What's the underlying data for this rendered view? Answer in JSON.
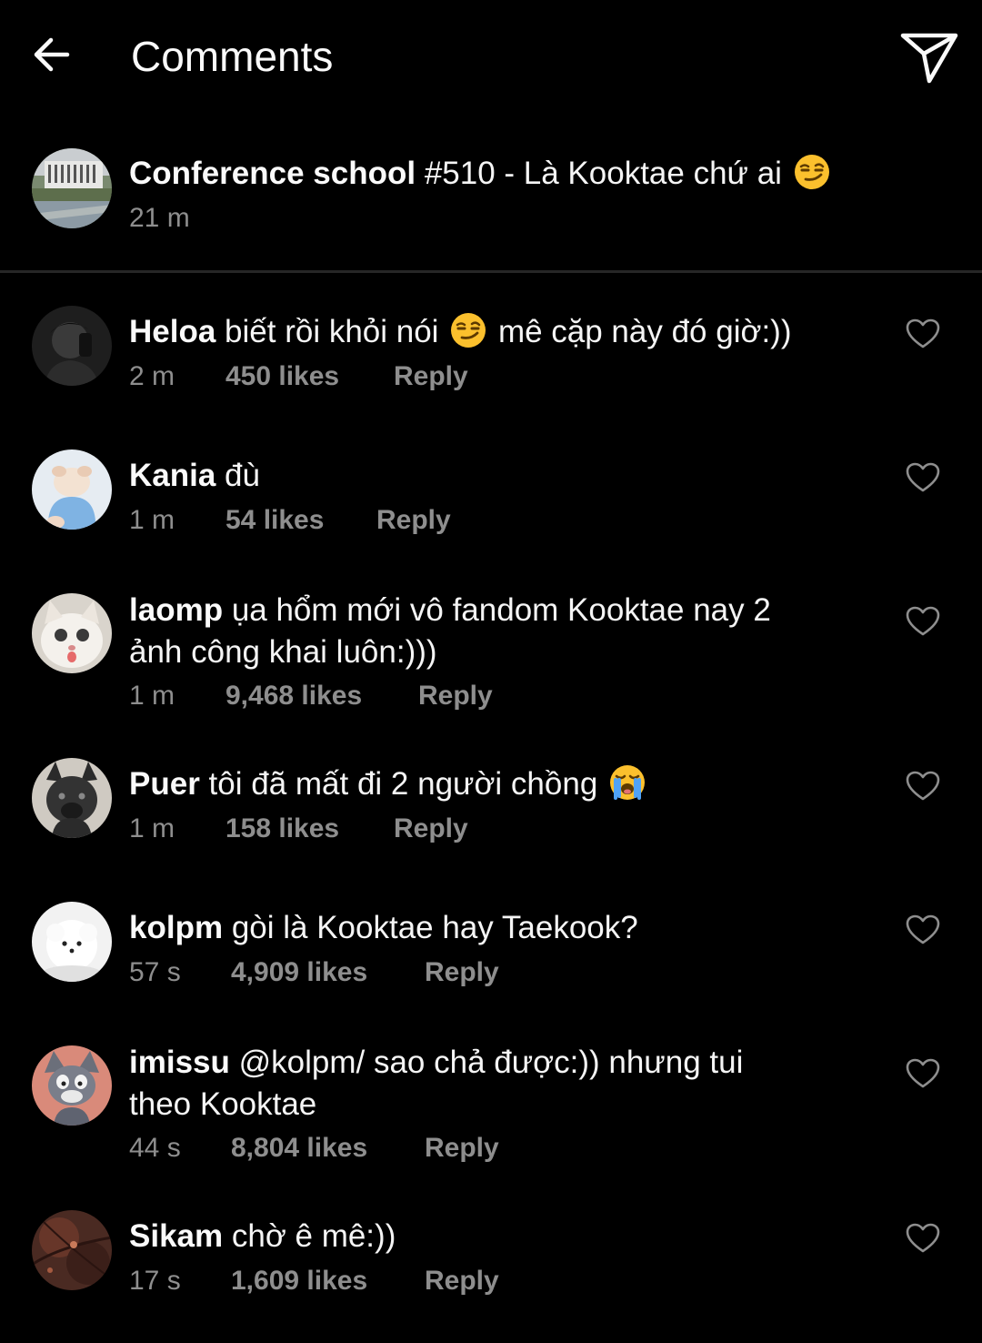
{
  "header": {
    "title": "Comments",
    "back_icon": "arrow-left-icon",
    "send_icon": "paper-plane-icon"
  },
  "caption": {
    "username": "Conference school",
    "text": "#510 - Là Kooktae chứ ai",
    "emoji": "smirk-emoji",
    "time": "21 m"
  },
  "comments": [
    {
      "username": "Heloa",
      "text_before": "biết rồi khỏi nói",
      "emoji": "smirk-emoji",
      "text_after": "mê cặp này đó giờ:))",
      "time": "2 m",
      "likes": "450 likes",
      "reply": "Reply"
    },
    {
      "username": "Kania",
      "text": "đù",
      "time": "1 m",
      "likes": "54 likes",
      "reply": "Reply"
    },
    {
      "username": "laomp",
      "text_line1": "ụa hổm mới vô fandom Kooktae nay 2",
      "text_line2": "ảnh công khai luôn:)))",
      "time": "1 m",
      "likes": "9,468 likes",
      "reply": "Reply"
    },
    {
      "username": "Puer",
      "text": "tôi đã mất đi 2 người chồng",
      "emoji": "loudly-crying-emoji",
      "time": "1 m",
      "likes": "158 likes",
      "reply": "Reply"
    },
    {
      "username": "kolpm",
      "text": "gòi là Kooktae hay Taekook?",
      "time": "57 s",
      "likes": "4,909 likes",
      "reply": "Reply"
    },
    {
      "username": "imissu",
      "text_line1": "@kolpm/ sao chả được:)) nhưng tui",
      "text_line2": "theo Kooktae",
      "time": "44 s",
      "likes": "8,804 likes",
      "reply": "Reply"
    },
    {
      "username": "Sikam",
      "text": "chờ ê mê:))",
      "time": "17 s",
      "likes": "1,609 likes",
      "reply": "Reply"
    }
  ],
  "colors": {
    "background": "#000000",
    "text": "#f5f5f5",
    "secondary": "#8e8e8e",
    "divider": "#262626"
  }
}
